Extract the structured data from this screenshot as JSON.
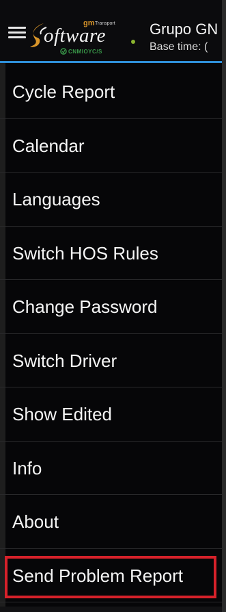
{
  "header": {
    "logo_main": "oftware",
    "logo_gm": "gm",
    "logo_transport": "Transport",
    "logo_sub": "CNMIOYC/S",
    "title": "Grupo GN",
    "subtitle": "Base time: ("
  },
  "menu": {
    "items": [
      {
        "label": "Cycle Report"
      },
      {
        "label": "Calendar"
      },
      {
        "label": "Languages"
      },
      {
        "label": "Switch HOS Rules"
      },
      {
        "label": "Change Password"
      },
      {
        "label": "Switch Driver"
      },
      {
        "label": "Show Edited"
      },
      {
        "label": "Info"
      },
      {
        "label": "About"
      },
      {
        "label": "Send Problem Report",
        "highlighted": true
      }
    ]
  },
  "colors": {
    "background": "#060608",
    "accent_line": "#2e8fd8",
    "highlight_border": "#d6212a",
    "logo_orange": "#d8952a",
    "logo_green": "#3a9a4a"
  },
  "icons": {
    "menu": "hamburger-menu-icon",
    "logo": "software-logo-icon"
  }
}
